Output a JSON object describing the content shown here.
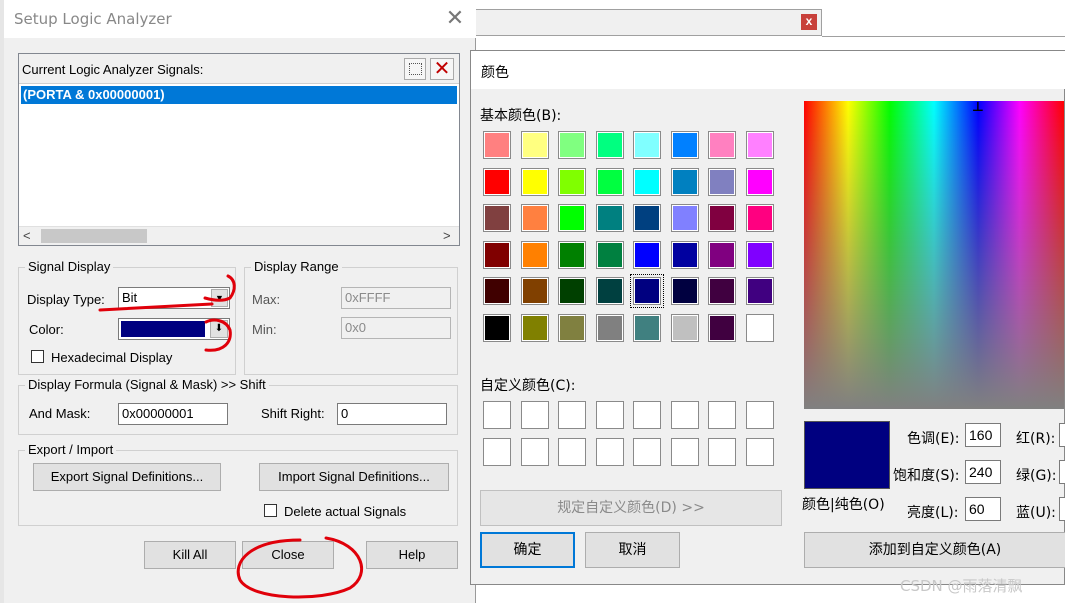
{
  "background_window": {
    "close_glyph": "x"
  },
  "setup": {
    "title": "Setup Logic Analyzer",
    "close_glyph": "✕",
    "signals": {
      "header": "Current Logic Analyzer Signals:",
      "delete_glyph": "✕",
      "items": [
        "(PORTA & 0x00000001)"
      ],
      "scroll_left": "<",
      "scroll_right": ">"
    },
    "signal_display": {
      "legend": "Signal Display",
      "display_type_label": "Display Type:",
      "display_type_value": "Bit",
      "color_label": "Color:",
      "color_value": "#000080",
      "hex_label": "Hexadecimal Display"
    },
    "display_range": {
      "legend": "Display Range",
      "max_label": "Max:",
      "max_value": "0xFFFF",
      "min_label": "Min:",
      "min_value": "0x0"
    },
    "formula": {
      "legend": "Display Formula (Signal & Mask) >> Shift",
      "mask_label": "And Mask:",
      "mask_value": "0x00000001",
      "shift_label": "Shift Right:",
      "shift_value": "0"
    },
    "export_import": {
      "legend": "Export / Import",
      "export_label": "Export Signal Definitions...",
      "import_label": "Import Signal Definitions...",
      "delete_label": "Delete actual Signals"
    },
    "buttons": {
      "kill_all": "Kill All",
      "close": "Close",
      "help": "Help"
    }
  },
  "color_dialog": {
    "title": "颜色",
    "basic_label": "基本颜色(B):",
    "basic_colors": [
      "#ff8080",
      "#ffff80",
      "#80ff80",
      "#00ff80",
      "#80ffff",
      "#0080ff",
      "#ff80c0",
      "#ff80ff",
      "#ff0000",
      "#ffff00",
      "#80ff00",
      "#00ff40",
      "#00ffff",
      "#0080c0",
      "#8080c0",
      "#ff00ff",
      "#804040",
      "#ff8040",
      "#00ff00",
      "#008080",
      "#004080",
      "#8080ff",
      "#800040",
      "#ff0080",
      "#800000",
      "#ff8000",
      "#008000",
      "#008040",
      "#0000ff",
      "#0000a0",
      "#800080",
      "#8000ff",
      "#400000",
      "#804000",
      "#004000",
      "#004040",
      "#000080",
      "#000040",
      "#400040",
      "#400080",
      "#000000",
      "#808000",
      "#808040",
      "#808080",
      "#408080",
      "#c0c0c0",
      "#400040",
      "#ffffff"
    ],
    "selected_index": 36,
    "custom_label": "自定义颜色(C):",
    "define_custom_label": "规定自定义颜色(D) >>",
    "ok_label": "确定",
    "cancel_label": "取消",
    "preview_label": "颜色|纯色(O)",
    "hue_label": "色调(E):",
    "hue_value": "160",
    "sat_label": "饱和度(S):",
    "sat_value": "240",
    "lum_label": "亮度(L):",
    "lum_value": "60",
    "red_label": "红(R):",
    "green_label": "绿(G):",
    "blue_label": "蓝(U):",
    "add_custom_label": "添加到自定义颜色(A)"
  },
  "watermark": "CSDN @雨落清飘"
}
